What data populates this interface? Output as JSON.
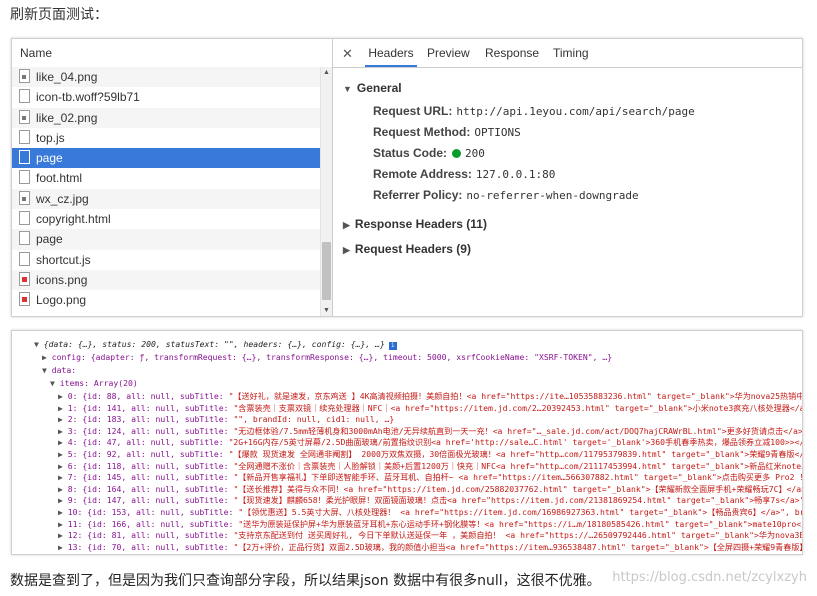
{
  "heading": "刷新页面测试：",
  "network": {
    "name_header": "Name",
    "files": [
      {
        "name": "like_04.png",
        "icon": "image-file-icon"
      },
      {
        "name": "icon-tb.woff?59lb71",
        "icon": "file-icon"
      },
      {
        "name": "like_02.png",
        "icon": "image-file-icon"
      },
      {
        "name": "top.js",
        "icon": "file-icon"
      },
      {
        "name": "page",
        "icon": "file-icon",
        "selected": true
      },
      {
        "name": "foot.html",
        "icon": "file-icon"
      },
      {
        "name": "wx_cz.jpg",
        "icon": "image-file-icon"
      },
      {
        "name": "copyright.html",
        "icon": "file-icon"
      },
      {
        "name": "page",
        "icon": "file-icon"
      },
      {
        "name": "shortcut.js",
        "icon": "file-icon"
      },
      {
        "name": "icons.png",
        "icon": "red-image-icon"
      },
      {
        "name": "Logo.png",
        "icon": "red-image-icon"
      }
    ],
    "tabs": [
      "Headers",
      "Preview",
      "Response",
      "Timing"
    ],
    "active_tab": "Headers",
    "general": {
      "title": "General",
      "request_url_label": "Request URL:",
      "request_url": "http://api.1eyou.com/api/search/page",
      "request_method_label": "Request Method:",
      "request_method": "OPTIONS",
      "status_code_label": "Status Code:",
      "status_code": "200",
      "remote_address_label": "Remote Address:",
      "remote_address": "127.0.0.1:80",
      "referrer_policy_label": "Referrer Policy:",
      "referrer_policy": "no-referrer-when-downgrade"
    },
    "response_headers": "Response Headers (11)",
    "request_headers": "Request Headers (9)"
  },
  "console": {
    "line0": "{data: {…}, status: 200, statusText: \"\", headers: {…}, config: {…}, …}",
    "line1": "config: {adapter: ƒ, transformRequest: {…}, transformResponse: {…}, timeout: 5000, xsrfCookieName: \"XSRF-TOKEN\", …}",
    "line2": "data:",
    "line3": "items: Array(20)",
    "items": [
      {
        "pre": "0: {id: 88, all: null, subTitle: ",
        "str": "\"【送好礼，就是速发，京东鸡送 】4K高清视频拍摄！美颜自拍！<a href=\"https://ite…10535883236.html\" target=\"_blank\">华为nova25热销中</a>"
      },
      {
        "pre": "1: {id: 141, all: null, subTitle: ",
        "str": "\"含票装壳｜支票双镜｜续充处理器｜NFC｜<a href=\"https://item.jd.com/2…20392453.html\" target=\"_blank\">小米note3疯充八核处理器</a>\", b"
      },
      {
        "pre": "2: {id: 183, all: null, subTitle: ",
        "str": "\"\", brandId: null, cid1: null, …}"
      },
      {
        "pre": "3: {id: 124, all: null, subTitle: ",
        "str": "\"无边框体验/7.5mm轻薄机身和3000mAh电池/无异续航直到一天一充！<a  href=\"…_sale.jd.com/act/DOQ7hajCRAWrBL.html\">更多好货请点击</a>\""
      },
      {
        "pre": "4: {id: 47, all: null, subTitle: ",
        "str": "\"2G+16G内存/5英寸屏幕/2.5D曲面玻璃/前置指纹识别<a href='http://sale…C.html' target='_blank'>360手机春季热卖，爆品领券立减100>></a>\", b"
      },
      {
        "pre": "5: {id: 92, all: null, subTitle: ",
        "str": "\"【爆款 现货速发 全网通非阉割】 2000万双焦双摄，30倍面极光玻璃！<a href=\"http…com/11795379839.html\" target=\"_blank\">荣耀9青春版</a>"
      },
      {
        "pre": "6: {id: 118, all: null, subTitle: ",
        "str": "\"全网通赠不涨价｜含票装壳｜人脸解锁｜美颜+后置1200万｜快充｜NFC<a href=\"http…com/21117453994.html\" target=\"_blank\">新品红米note5</a>"
      },
      {
        "pre": "7: {id: 145, all: null, subTitle: ",
        "str": "\"【新品开售享福礼】下单即送智能手环、蓝牙耳机、自拍杆~ <a href=\"https://item…566307882.html\" target=\"_blank\">点击购买更多 Pro2 ！</a>"
      },
      {
        "pre": "8: {id: 164, all: null, subTitle: ",
        "str": "\"【送长推荐】美得与众不同！<a href=\"https://item.jd.com/25882037762.html\" target=\"_blank\">【荣耀新款全面屏手机+荣耀畅玩7C】</a>\", b"
      },
      {
        "pre": "9: {id: 147, all: null, subTitle: ",
        "str": "\"【现货速发】麒麟658！柔光护眼屏！双面镜面玻璃！点击<a href=\"https://item.jd.com/21381869254.html\" target=\"_blank\">畅享7s</a>\", bra"
      },
      {
        "pre": "10: {id: 153, all: null, subTitle: ",
        "str": "\"【领优惠送】5.5英寸大屏、八核处理器！ <a href=\"https://item.jd.com/16986927363.html\" target=\"_blank\">【畅品贵宾6】</a>\", brandId"
      },
      {
        "pre": "11: {id: 166, all: null, subTitle: ",
        "str": "\"送华为原装延保护屏+华为原装蓝牙耳机+东心运动手环+钢化膜等！<a href=\"https://i…m/18180585426.html\" target=\"_blank\">mate10pro</a>"
      },
      {
        "pre": "12: {id: 81, all: null, subTitle: ",
        "str": "\"支持京东配送到付 送买周好礼, 今日下单默认送延保一年 ，美颜自拍！ <a href=\"https://…26509792446.html\" target=\"_blank\">华为nova3E热卖中</a>"
      },
      {
        "pre": "13: {id: 70, all: null, subTitle: ",
        "str": "\"【2万+评价，正品行货】双面2.5D玻璃，我的颜值小担当<a href=\"https://item…936538487.html\" target=\"_blank\">【全屏四摄+荣耀9青春版】</a>"
      }
    ]
  },
  "footer": "数据是查到了，但是因为我们只查询部分字段，所以结果json 数据中有很多null，这很不优雅。",
  "watermark": "https://blog.csdn.net/zcylxzyh"
}
